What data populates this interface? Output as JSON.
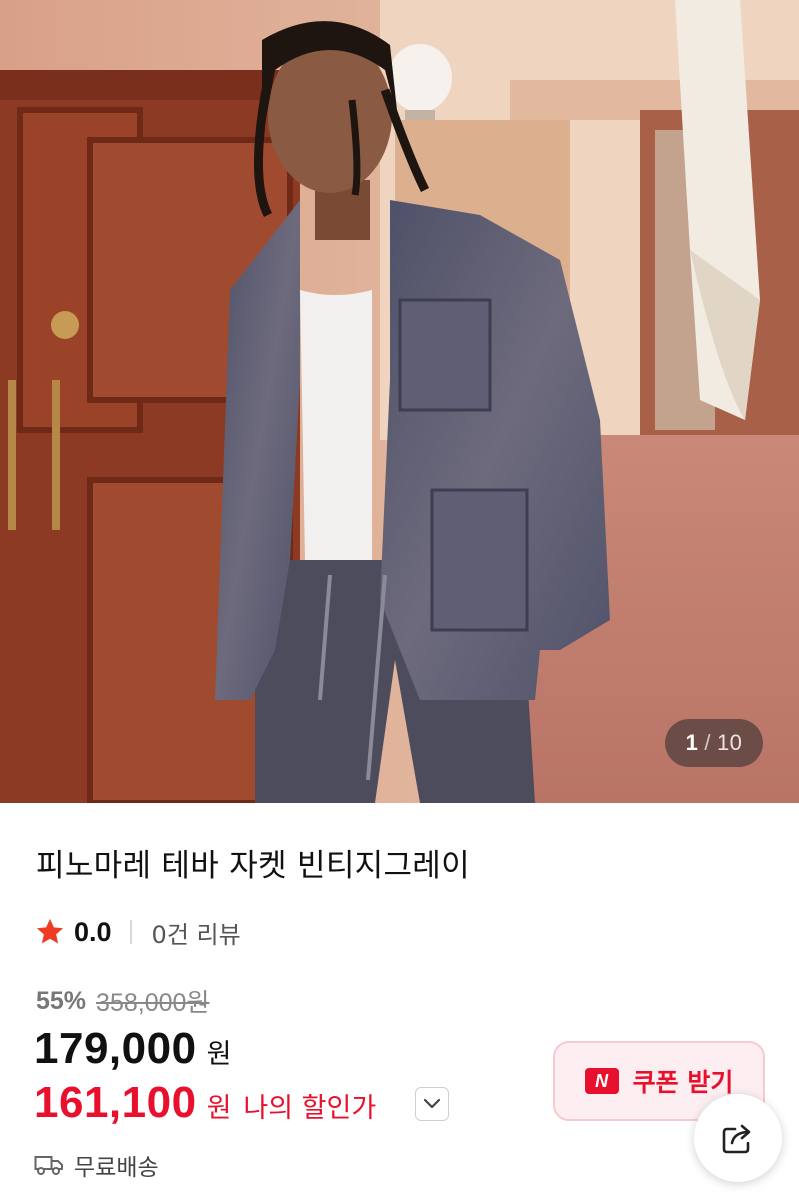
{
  "gallery": {
    "current": "1",
    "separator": "/",
    "total": "10"
  },
  "product": {
    "title": "피노마레 테바 자켓 빈티지그레이",
    "rating": "0.0",
    "review_count": "0건 리뷰",
    "discount_pct": "55%",
    "original_price": "358,000원",
    "price": "179,000",
    "price_unit": "원",
    "my_price": "161,100",
    "my_price_unit": "원",
    "my_price_label": "나의 할인가",
    "shipping": "무료배송"
  },
  "actions": {
    "coupon_badge": "N",
    "coupon_label": "쿠폰 받기"
  },
  "colors": {
    "accent_red": "#e8112d",
    "coupon_bg": "#fdeff1"
  },
  "icons": {
    "rating": "star-icon",
    "expand": "chevron-down-icon",
    "shipping": "truck-icon",
    "share": "share-icon"
  }
}
